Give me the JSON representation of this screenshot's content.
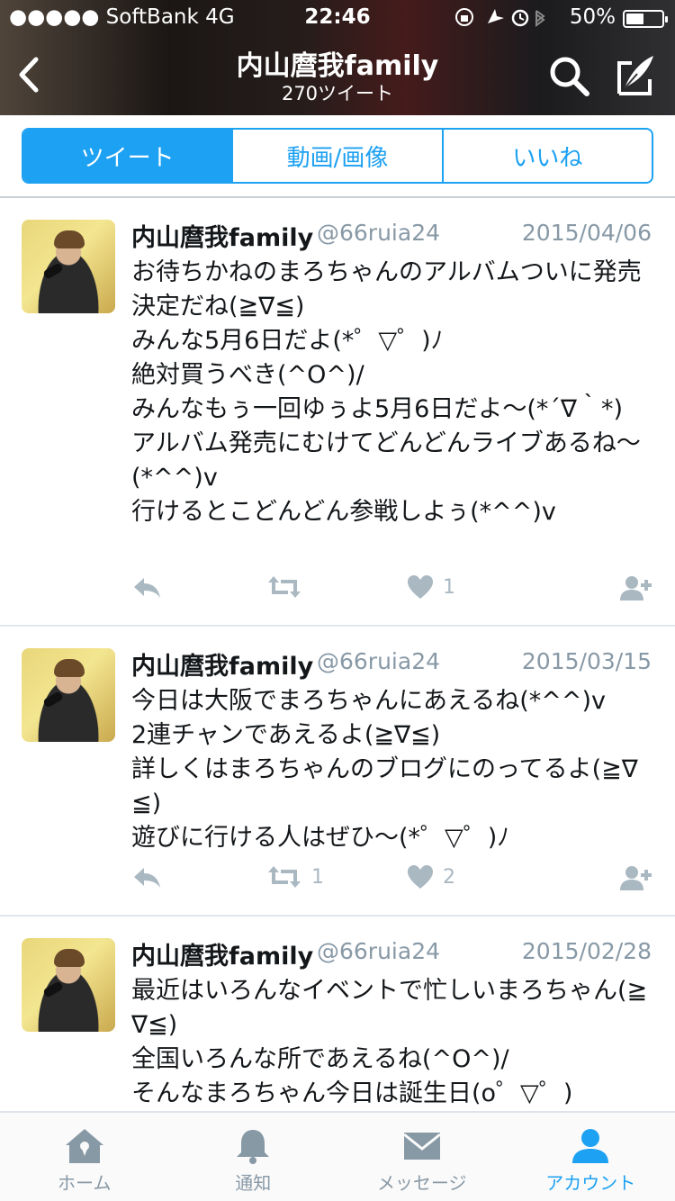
{
  "status_bar": {
    "carrier": "●●●●● SoftBank   4G",
    "time": "22:46",
    "battery": "50%",
    "battery_level": 0.5
  },
  "header": {
    "title": "内山麿我family",
    "subtitle": "270ツイート"
  },
  "segments": [
    {
      "label": "ツイート",
      "active": true
    },
    {
      "label": "動画/画像",
      "active": false
    },
    {
      "label": "いいね",
      "active": false
    }
  ],
  "tweets": [
    {
      "name": "内山麿我family",
      "handle": "@66ruia24",
      "date": "2015/04/06",
      "text": "お待ちかねのまろちゃんのアルバムついに発売決定だね(≧∇≦)\nみんな5月6日だよ(*゜▽゜)ﾉ\n絶対買うべき(^O^)/\nみんなもぅ一回ゆぅよ5月6日だよ〜(*´∇｀*)\nアルバム発売にむけてどんどんライブあるね〜(*^^)v\n行けるとこどんどん参戦しよぅ(*^^)v",
      "retweets": "",
      "likes": "1"
    },
    {
      "name": "内山麿我family",
      "handle": "@66ruia24",
      "date": "2015/03/15",
      "text": "今日は大阪でまろちゃんにあえるね(*^^)v\n2連チャンであえるよ(≧∇≦)\n詳しくはまろちゃんのブログにのってるよ(≧∇≦)\n遊びに行ける人はぜひ〜(*゜▽゜)ﾉ",
      "retweets": "1",
      "likes": "2"
    },
    {
      "name": "内山麿我family",
      "handle": "@66ruia24",
      "date": "2015/02/28",
      "text": "最近はいろんなイベントで忙しいまろちゃん(≧∇≦)\n全国いろんな所であえるね(^O^)/\nそんなまろちゃん今日は誕生日(o゜▽゜)",
      "retweets": "",
      "likes": ""
    }
  ],
  "tabbar": [
    {
      "label": "ホーム",
      "icon": "home-icon",
      "active": false
    },
    {
      "label": "通知",
      "icon": "bell-icon",
      "active": false
    },
    {
      "label": "メッセージ",
      "icon": "envelope-icon",
      "active": false
    },
    {
      "label": "アカウント",
      "icon": "person-icon",
      "active": true
    }
  ],
  "colors": {
    "accent": "#1da1f2",
    "icon_gray": "#aab8c2",
    "meta_gray": "#8899a6"
  }
}
